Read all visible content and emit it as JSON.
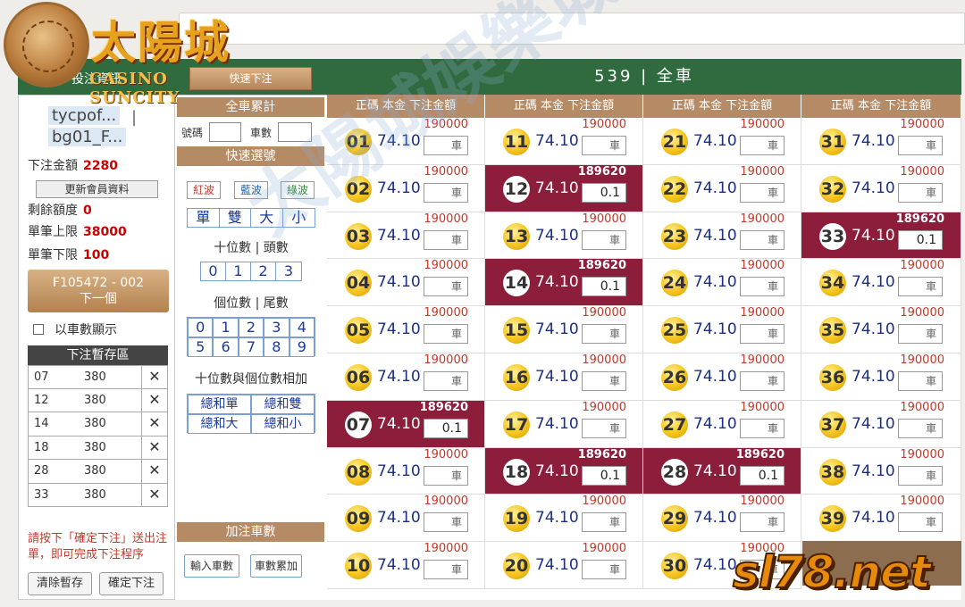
{
  "logo": {
    "cn": "太陽城",
    "en": "CASINO SUNCITY"
  },
  "header": {
    "bet_info": "投注資訊",
    "quick_bet_label": "快速下注",
    "game_title": "539 | 全車"
  },
  "left": {
    "user1": "tycpof...",
    "separator": "|",
    "user2": "bg01_F...",
    "bet_amount_label": "下注金額",
    "bet_amount_value": "2280",
    "update_label": "更新會員資料",
    "remaining_label": "剩餘額度",
    "remaining_value": "0",
    "max_label": "單筆上限",
    "max_value": "38000",
    "min_label": "單筆下限",
    "min_value": "100",
    "next_code": "F105472 - 002",
    "next_label": "下一個",
    "show_by_count_label": "以車數顯示",
    "temp_title": "下注暫存區",
    "temp_items": [
      {
        "num": "07",
        "amt": "380",
        "x": "✕"
      },
      {
        "num": "12",
        "amt": "380",
        "x": "✕"
      },
      {
        "num": "14",
        "amt": "380",
        "x": "✕"
      },
      {
        "num": "18",
        "amt": "380",
        "x": "✕"
      },
      {
        "num": "28",
        "amt": "380",
        "x": "✕"
      },
      {
        "num": "33",
        "amt": "380",
        "x": "✕"
      }
    ],
    "note": "請按下「確定下注」送出注單，即可完成下注程序",
    "clear_label": "清除暫存",
    "confirm_label": "確定下注"
  },
  "mid": {
    "total_title": "全車累計",
    "code_label": "號碼",
    "count_label": "車數",
    "quick_title": "快速選號",
    "red": "紅波",
    "blue": "藍波",
    "green": "綠波",
    "odd": "單",
    "even": "雙",
    "big": "大",
    "small": "小",
    "tens_label": "十位數 | 頭數",
    "tens": [
      "0",
      "1",
      "2",
      "3"
    ],
    "ones_label": "個位數 | 尾數",
    "ones": [
      "0",
      "1",
      "2",
      "3",
      "4",
      "5",
      "6",
      "7",
      "8",
      "9"
    ],
    "sum_label": "十位數與個位數相加",
    "sum_odd": "總和單",
    "sum_even": "總和雙",
    "sum_big": "總和大",
    "sum_small": "總和小",
    "add_title": "加注車數",
    "input_count": "輸入車數",
    "accumulate": "車數累加"
  },
  "grid": {
    "col_header": "正碼  本金  下注金額",
    "rows": [
      [
        {
          "n": "01",
          "o": "74.10",
          "l": "190000",
          "v": "車",
          "h": false
        },
        {
          "n": "11",
          "o": "74.10",
          "l": "190000",
          "v": "車",
          "h": false
        },
        {
          "n": "21",
          "o": "74.10",
          "l": "190000",
          "v": "車",
          "h": false
        },
        {
          "n": "31",
          "o": "74.10",
          "l": "190000",
          "v": "車",
          "h": false
        }
      ],
      [
        {
          "n": "02",
          "o": "74.10",
          "l": "190000",
          "v": "車",
          "h": false
        },
        {
          "n": "12",
          "o": "74.10",
          "l": "189620",
          "v": "0.1",
          "h": true
        },
        {
          "n": "22",
          "o": "74.10",
          "l": "190000",
          "v": "車",
          "h": false
        },
        {
          "n": "32",
          "o": "74.10",
          "l": "190000",
          "v": "車",
          "h": false
        }
      ],
      [
        {
          "n": "03",
          "o": "74.10",
          "l": "190000",
          "v": "車",
          "h": false
        },
        {
          "n": "13",
          "o": "74.10",
          "l": "190000",
          "v": "車",
          "h": false
        },
        {
          "n": "23",
          "o": "74.10",
          "l": "190000",
          "v": "車",
          "h": false
        },
        {
          "n": "33",
          "o": "74.10",
          "l": "189620",
          "v": "0.1",
          "h": true
        }
      ],
      [
        {
          "n": "04",
          "o": "74.10",
          "l": "190000",
          "v": "車",
          "h": false
        },
        {
          "n": "14",
          "o": "74.10",
          "l": "189620",
          "v": "0.1",
          "h": true
        },
        {
          "n": "24",
          "o": "74.10",
          "l": "190000",
          "v": "車",
          "h": false
        },
        {
          "n": "34",
          "o": "74.10",
          "l": "190000",
          "v": "車",
          "h": false
        }
      ],
      [
        {
          "n": "05",
          "o": "74.10",
          "l": "190000",
          "v": "車",
          "h": false
        },
        {
          "n": "15",
          "o": "74.10",
          "l": "190000",
          "v": "車",
          "h": false
        },
        {
          "n": "25",
          "o": "74.10",
          "l": "190000",
          "v": "車",
          "h": false
        },
        {
          "n": "35",
          "o": "74.10",
          "l": "190000",
          "v": "車",
          "h": false
        }
      ],
      [
        {
          "n": "06",
          "o": "74.10",
          "l": "190000",
          "v": "車",
          "h": false
        },
        {
          "n": "16",
          "o": "74.10",
          "l": "190000",
          "v": "車",
          "h": false
        },
        {
          "n": "26",
          "o": "74.10",
          "l": "190000",
          "v": "車",
          "h": false
        },
        {
          "n": "36",
          "o": "74.10",
          "l": "190000",
          "v": "車",
          "h": false
        }
      ],
      [
        {
          "n": "07",
          "o": "74.10",
          "l": "189620",
          "v": "0.1",
          "h": true
        },
        {
          "n": "17",
          "o": "74.10",
          "l": "190000",
          "v": "車",
          "h": false
        },
        {
          "n": "27",
          "o": "74.10",
          "l": "190000",
          "v": "車",
          "h": false
        },
        {
          "n": "37",
          "o": "74.10",
          "l": "190000",
          "v": "車",
          "h": false
        }
      ],
      [
        {
          "n": "08",
          "o": "74.10",
          "l": "190000",
          "v": "車",
          "h": false
        },
        {
          "n": "18",
          "o": "74.10",
          "l": "189620",
          "v": "0.1",
          "h": true
        },
        {
          "n": "28",
          "o": "74.10",
          "l": "189620",
          "v": "0.1",
          "h": true
        },
        {
          "n": "38",
          "o": "74.10",
          "l": "190000",
          "v": "車",
          "h": false
        }
      ],
      [
        {
          "n": "09",
          "o": "74.10",
          "l": "190000",
          "v": "車",
          "h": false
        },
        {
          "n": "19",
          "o": "74.10",
          "l": "190000",
          "v": "車",
          "h": false
        },
        {
          "n": "29",
          "o": "74.10",
          "l": "190000",
          "v": "車",
          "h": false
        },
        {
          "n": "39",
          "o": "74.10",
          "l": "190000",
          "v": "車",
          "h": false
        }
      ],
      [
        {
          "n": "10",
          "o": "74.10",
          "l": "190000",
          "v": "車",
          "h": false
        },
        {
          "n": "20",
          "o": "74.10",
          "l": "190000",
          "v": "車",
          "h": false
        },
        {
          "n": "30",
          "o": "74.10",
          "l": "190000",
          "v": "車",
          "h": false
        }
      ]
    ]
  },
  "watermark": "太陽城娛樂城提供",
  "site_logo": "sl78.net"
}
